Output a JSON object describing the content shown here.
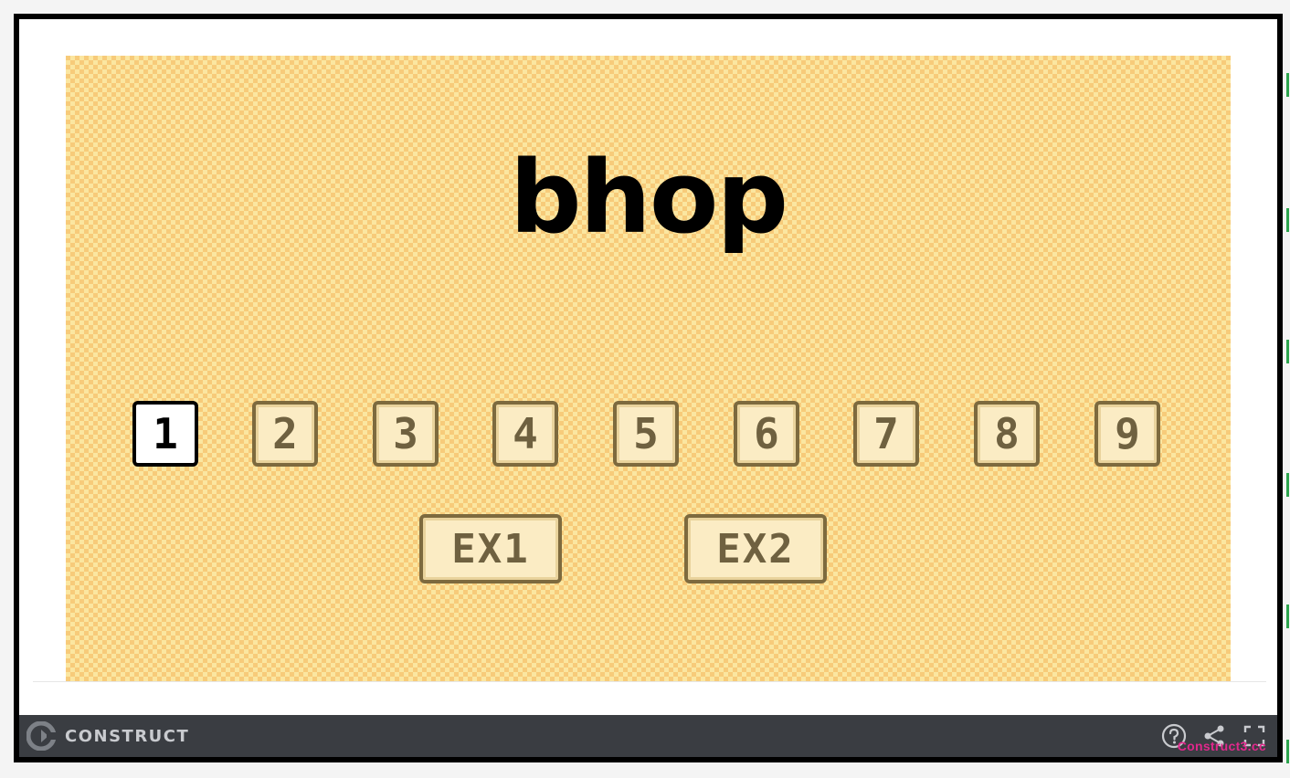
{
  "game": {
    "title": "bhop",
    "levels": [
      {
        "label": "1",
        "selected": true
      },
      {
        "label": "2",
        "selected": false
      },
      {
        "label": "3",
        "selected": false
      },
      {
        "label": "4",
        "selected": false
      },
      {
        "label": "5",
        "selected": false
      },
      {
        "label": "6",
        "selected": false
      },
      {
        "label": "7",
        "selected": false
      },
      {
        "label": "8",
        "selected": false
      },
      {
        "label": "9",
        "selected": false
      }
    ],
    "extras": [
      {
        "label": "EX1"
      },
      {
        "label": "EX2"
      }
    ]
  },
  "footer": {
    "brand": "CONSTRUCT",
    "icons": [
      "help-icon",
      "share-icon",
      "fullscreen-icon"
    ],
    "watermark": "Construct3.cc"
  },
  "colors": {
    "frame_border": "#000000",
    "checker_light": "#fbe6a0",
    "checker_dark": "#f7cb7a",
    "button_fill": "#fbecc4",
    "button_border": "#7d6a3e",
    "footer_bg": "#3a3d42",
    "watermark": "#e0288c"
  }
}
